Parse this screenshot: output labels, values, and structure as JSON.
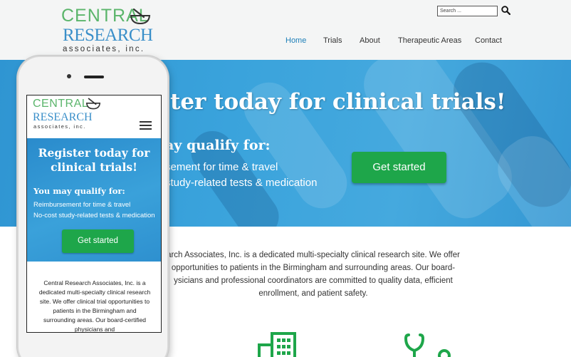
{
  "brand": {
    "line1": "CENTRAL",
    "line2": "RESEARCH",
    "line3": "associates, inc.",
    "green": "#5bb56b",
    "blue": "#3a8fc9"
  },
  "search": {
    "placeholder": "Search ...",
    "icon": "search-icon"
  },
  "nav": {
    "items": [
      {
        "label": "Home",
        "active": true
      },
      {
        "label": "Trials",
        "active": false
      },
      {
        "label": "About",
        "active": false
      },
      {
        "label": "Therapeutic Areas",
        "active": false
      },
      {
        "label": "Contact",
        "active": false
      }
    ],
    "active_color": "#1d7fb8"
  },
  "hero": {
    "title_visible": "ter today for clinical trials!",
    "subtitle_visible": "ay qualify for:",
    "bullet1_visible": "sement for time & travel",
    "bullet2_visible": "study-related tests & medication",
    "cta": "Get started",
    "cta_color": "#1ea64a"
  },
  "intro": {
    "line1": "arch Associates, Inc. is a dedicated multi-specialty clinical research site. We offer",
    "line2": "opportunities to patients in the Birmingham and surrounding areas. Our board-",
    "line3": "ysicians and professional coordinators are committed to quality data, efficient",
    "line4": "enrollment, and patient safety."
  },
  "features": {
    "icons": [
      "building-icon",
      "stethoscope-icon"
    ],
    "color": "#1ea64a"
  },
  "mobile": {
    "hero_title": "Register today for clinical trials!",
    "subtitle": "You may qualify for:",
    "bullet1": "Reimbursement for time & travel",
    "bullet2": "No-cost study-related tests & medication",
    "cta": "Get started",
    "intro": "Central Research Associates, Inc. is a dedicated multi-specialty clinical research site. We offer clinical trial opportunities to patients in the Birmingham and surrounding areas. Our board-certified physicians and",
    "menu_icon": "hamburger-menu-icon"
  }
}
